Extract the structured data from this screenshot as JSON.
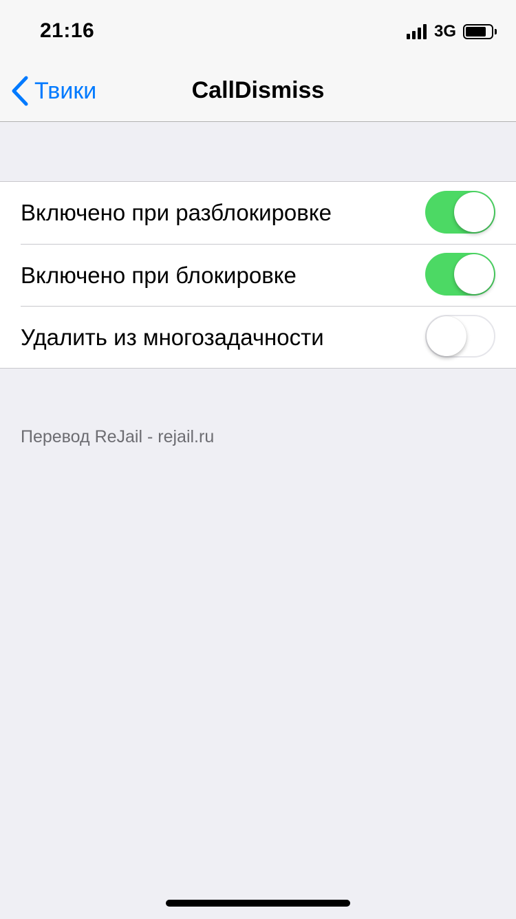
{
  "status_bar": {
    "time": "21:16",
    "network": "3G",
    "signal_icon": "cellular-signal-icon",
    "battery_icon": "battery-icon",
    "battery_level": 0.8
  },
  "nav": {
    "back_label": "Твики",
    "back_icon": "chevron-left-icon",
    "title": "CallDismiss",
    "accent_color": "#007aff"
  },
  "settings": {
    "toggle_on_color": "#4cd964",
    "items": [
      {
        "label": "Включено при разблокировке",
        "enabled": true
      },
      {
        "label": "Включено при блокировке",
        "enabled": true
      },
      {
        "label": "Удалить из многозадачности",
        "enabled": false
      }
    ]
  },
  "footer": {
    "note": "Перевод ReJail - rejail.ru"
  }
}
